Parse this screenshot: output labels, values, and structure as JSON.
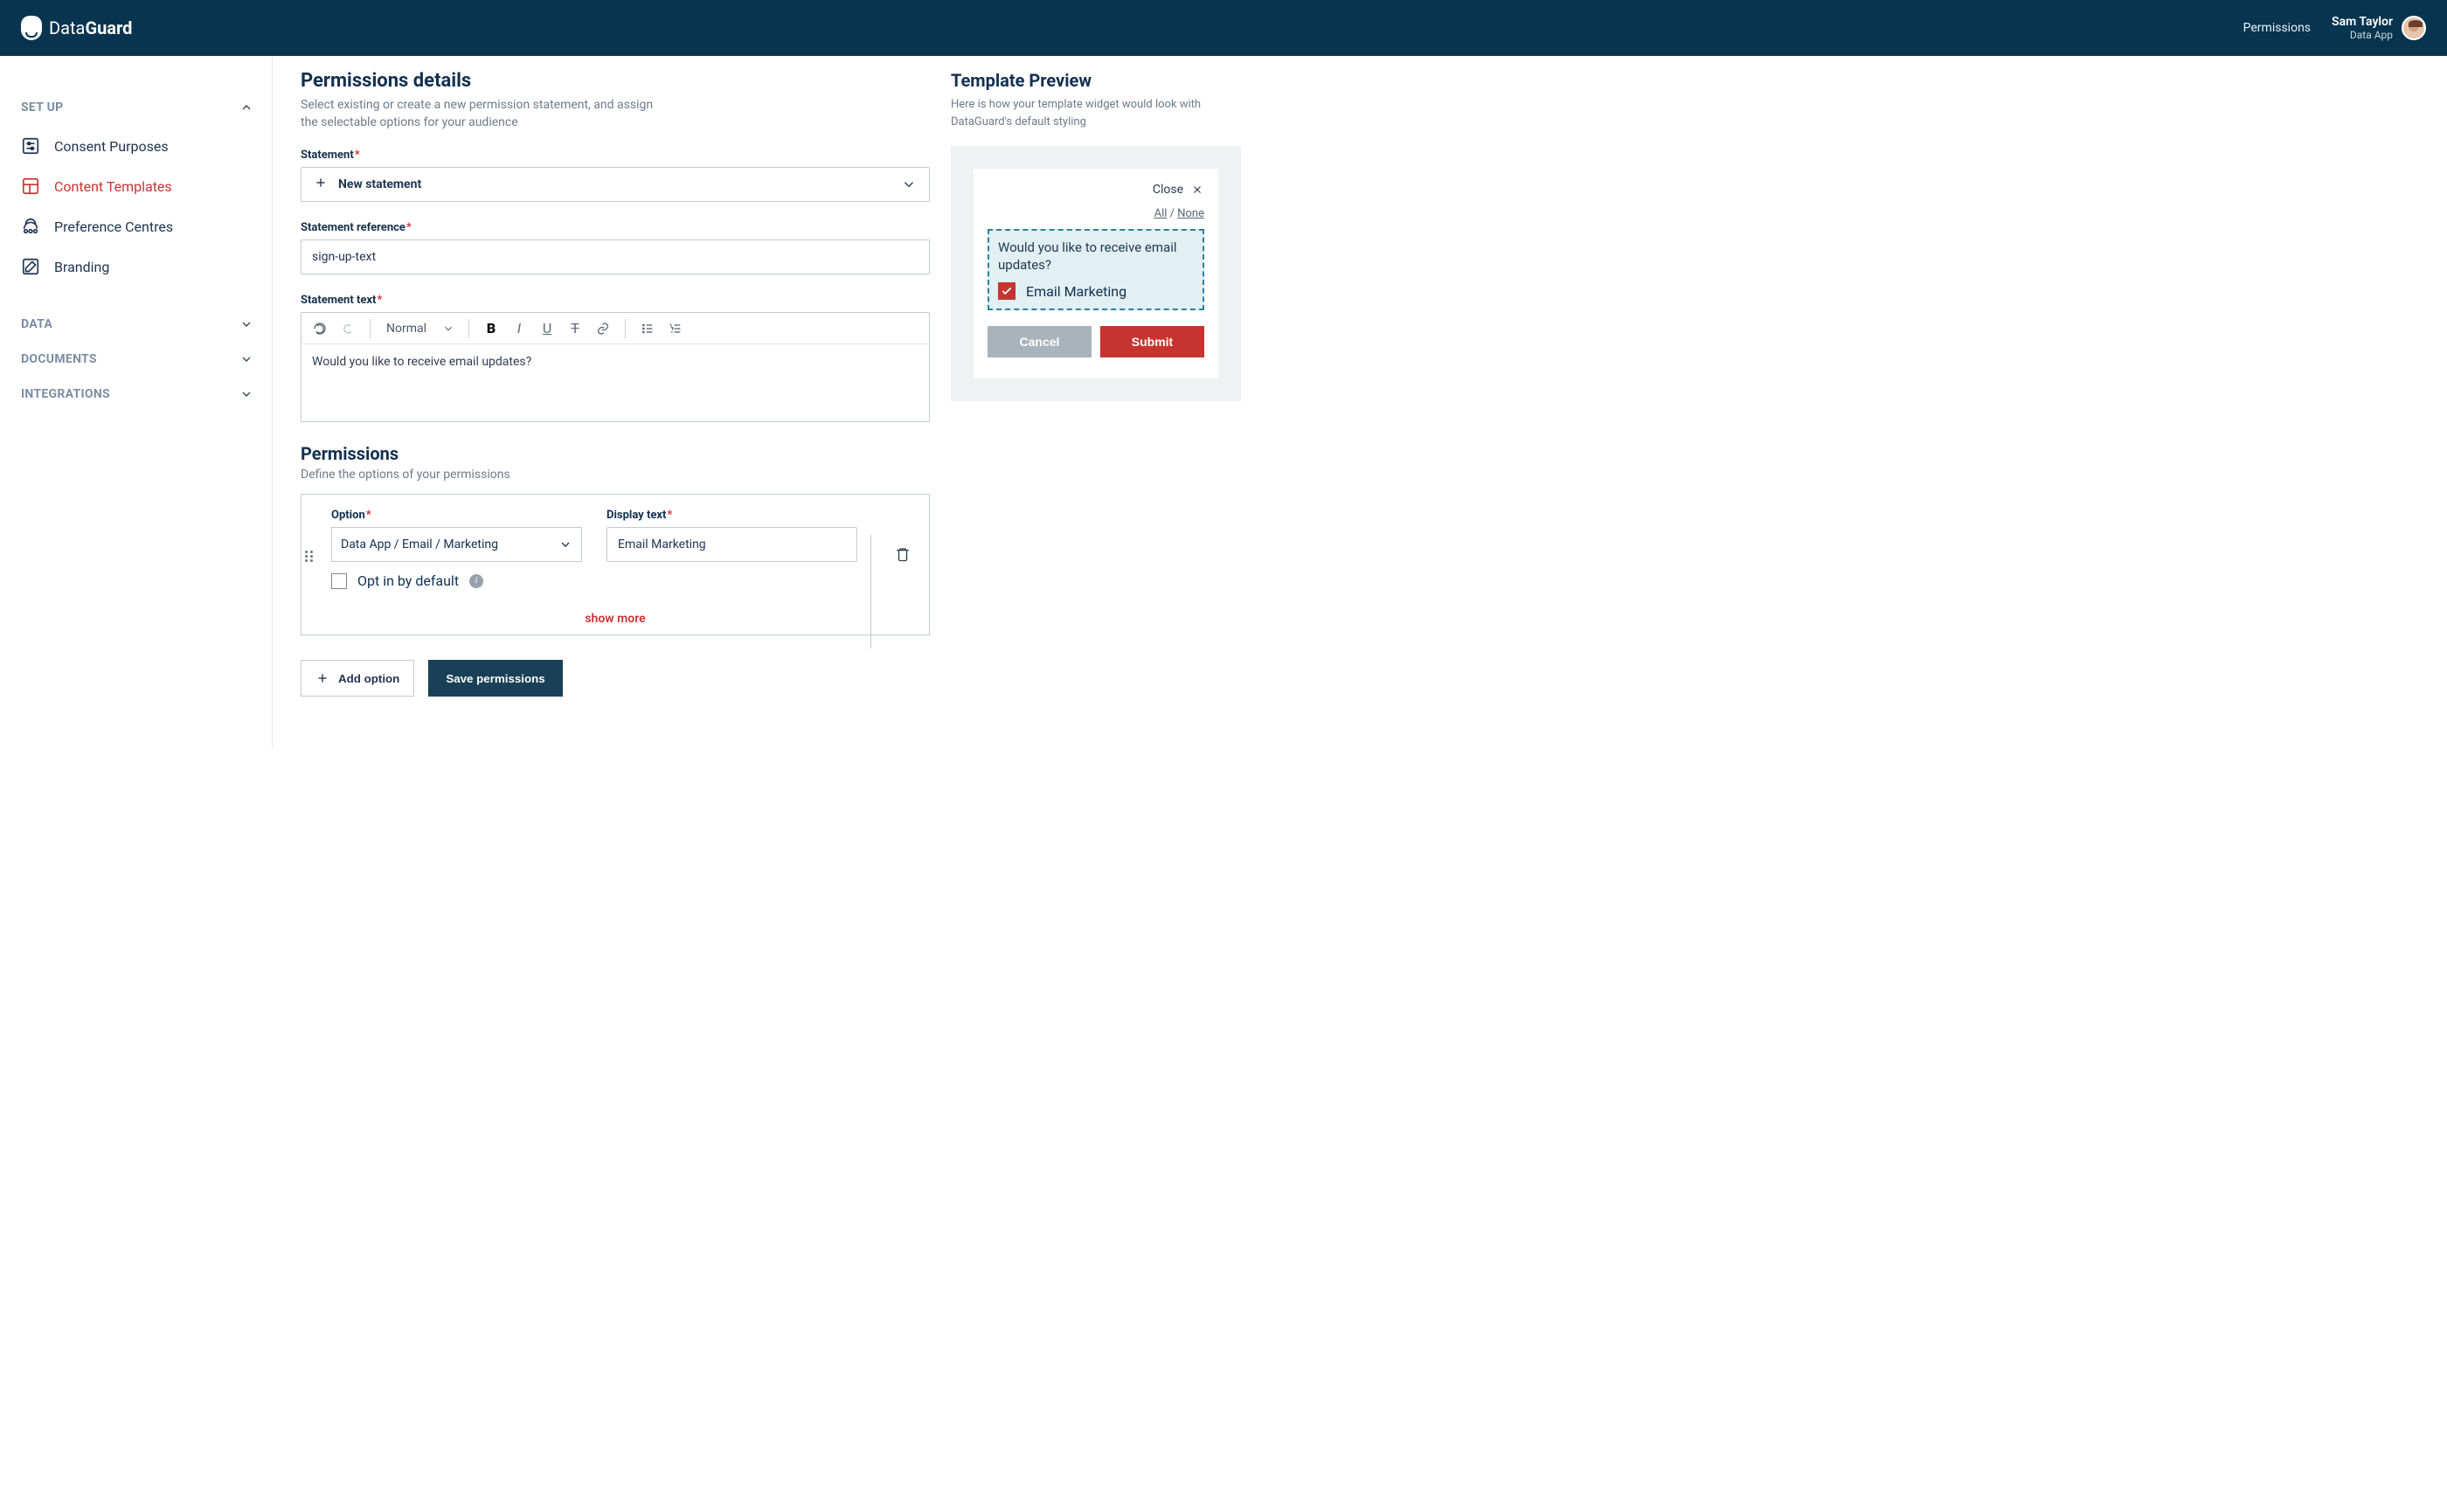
{
  "header": {
    "brand_first": "Data",
    "brand_bold": "Guard",
    "link_permissions": "Permissions",
    "user_name": "Sam Taylor",
    "user_app": "Data App"
  },
  "sidebar": {
    "sections": {
      "setup": "SET UP",
      "data": "DATA",
      "documents": "DOCUMENTS",
      "integrations": "INTEGRATIONS"
    },
    "items": {
      "consent": "Consent Purposes",
      "content": "Content Templates",
      "pref": "Preference Centres",
      "branding": "Branding"
    }
  },
  "details": {
    "title": "Permissions details",
    "subtitle": "Select existing or create a new permission statement, and assign the selectable options for your audience",
    "statement_label": "Statement",
    "statement_dd": "New statement",
    "ref_label": "Statement reference",
    "ref_value": "sign-up-text",
    "text_label": "Statement text",
    "style_select": "Normal",
    "editor_value": "Would you like to receive email updates?"
  },
  "perms": {
    "title": "Permissions",
    "subtitle": "Define the options of your permissions",
    "option_label": "Option",
    "option_value": "Data App / Email / Marketing",
    "display_label": "Display text",
    "display_value": "Email Marketing",
    "optin_label": "Opt in by default",
    "show_more": "show more",
    "add_option": "Add option",
    "save": "Save permissions"
  },
  "preview": {
    "title": "Template Preview",
    "desc": "Here is how your template widget would look with DataGuard's default styling",
    "close": "Close",
    "all": "All",
    "none": "None",
    "sep": " / ",
    "statement": "Would you like to receive email updates?",
    "option": "Email Marketing",
    "cancel": "Cancel",
    "submit": "Submit"
  }
}
